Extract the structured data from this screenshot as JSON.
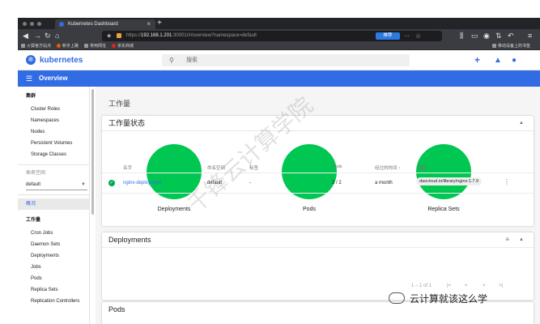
{
  "browser": {
    "tab_title": "Kubernetes Dashboard",
    "new_tab": "+",
    "url_scheme": "https://",
    "url_host": "192.168.1.201",
    "url_path": ":30001/#/overview?namespace=default",
    "recommend_label": "推荐",
    "bookmarks": [
      "火狐官方站点",
      "新手上路",
      "常用网址",
      "京东商城"
    ],
    "mobile_bookmark": "移动设备上的书签"
  },
  "app": {
    "brand": "kubernetes",
    "search_placeholder": "搜索",
    "toolbar_title": "Overview"
  },
  "sidebar": {
    "cluster_header": "集群",
    "cluster_items": [
      "Cluster Roles",
      "Namespaces",
      "Nodes",
      "Persistent Volumes",
      "Storage Classes"
    ],
    "namespace_label": "命名空间",
    "namespace_value": "default",
    "overview": "概况",
    "workloads_header": "工作量",
    "workload_items": [
      "Cron Jobs",
      "Daemon Sets",
      "Deployments",
      "Jobs",
      "Pods",
      "Replica Sets",
      "Replication Controllers"
    ]
  },
  "main": {
    "page_title": "工作量",
    "status_card_title": "工作量状态",
    "donuts": [
      "Deployments",
      "Pods",
      "Replica Sets"
    ],
    "deployments_card_title": "Deployments",
    "columns": [
      "名字",
      "命名空间",
      "标签",
      "Pods",
      "经过的时间",
      "镜像"
    ],
    "sort_arrow": "↑",
    "row": {
      "name": "nginx-deployment",
      "namespace": "default",
      "labels": "-",
      "pods": "2 / 2",
      "age": "a month",
      "image": "daocloud.io/library/nginx:1.7.9"
    },
    "pagination": "1 – 1 of 1",
    "pods_card_title": "Pods"
  },
  "watermark": {
    "diagonal": "千锋云计算学院",
    "wechat": "云计算就该这么学"
  },
  "colors": {
    "brand": "#326ce5",
    "success": "#00c752"
  }
}
